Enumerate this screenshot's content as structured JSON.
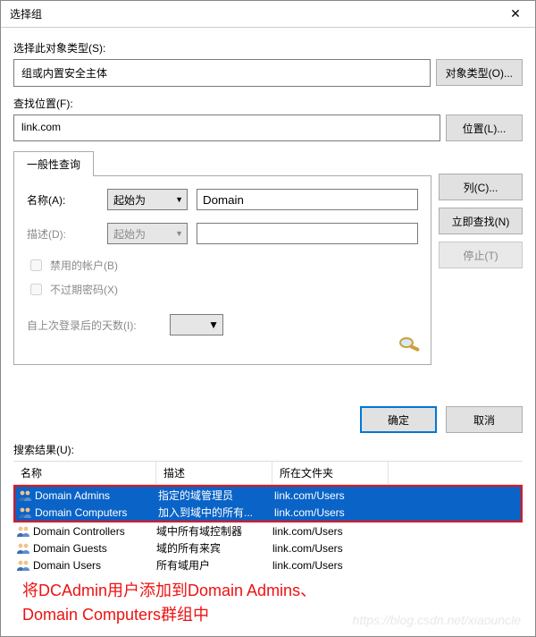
{
  "title": "选择组",
  "close_glyph": "✕",
  "section1": {
    "label": "选择此对象类型(S):",
    "value": "组或内置安全主体",
    "button": "对象类型(O)..."
  },
  "section2": {
    "label": "查找位置(F):",
    "value": "link.com",
    "button": "位置(L)..."
  },
  "tab_label": "一般性查询",
  "panel": {
    "name_label": "名称(A):",
    "name_combo": "起始为",
    "name_value": "Domain",
    "desc_label": "描述(D):",
    "desc_combo": "起始为",
    "desc_value": "",
    "chk_disabled": "禁用的帐户(B)",
    "chk_noexpire": "不过期密码(X)",
    "days_label": "自上次登录后的天数(I):"
  },
  "right_buttons": {
    "columns": "列(C)...",
    "find_now": "立即查找(N)",
    "stop": "停止(T)"
  },
  "footer": {
    "ok": "确定",
    "cancel": "取消"
  },
  "results_label": "搜索结果(U):",
  "columns": {
    "name": "名称",
    "desc": "描述",
    "folder": "所在文件夹"
  },
  "rows": [
    {
      "name": "Domain Admins",
      "desc": "指定的域管理员",
      "folder": "link.com/Users",
      "selected": true
    },
    {
      "name": "Domain Computers",
      "desc": "加入到域中的所有...",
      "folder": "link.com/Users",
      "selected": true
    },
    {
      "name": "Domain Controllers",
      "desc": "域中所有域控制器",
      "folder": "link.com/Users",
      "selected": false
    },
    {
      "name": "Domain Guests",
      "desc": "域的所有来宾",
      "folder": "link.com/Users",
      "selected": false
    },
    {
      "name": "Domain Users",
      "desc": "所有域用户",
      "folder": "link.com/Users",
      "selected": false
    }
  ],
  "annotation_line1": "将DCAdmin用户添加到Domain Admins、",
  "annotation_line2": "Domain Computers群组中",
  "watermark": "https://blog.csdn.net/xiaouncle"
}
